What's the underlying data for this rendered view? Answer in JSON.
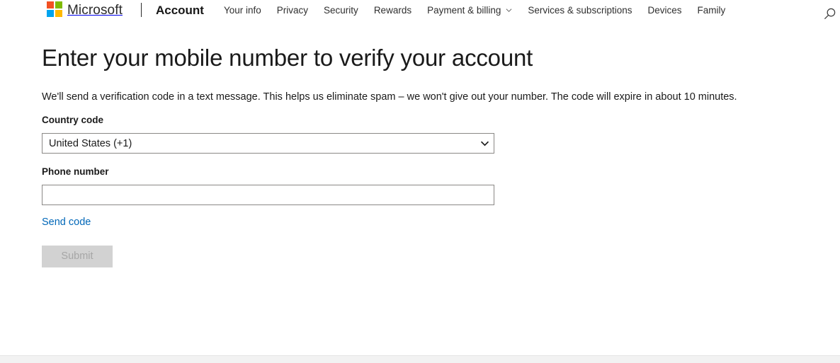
{
  "header": {
    "brand_name": "Microsoft",
    "logo_colors": {
      "top_left": "#f25022",
      "top_right": "#7fba00",
      "bottom_left": "#00a4ef",
      "bottom_right": "#ffb900"
    },
    "section_title": "Account",
    "nav_items": [
      {
        "label": "Your info",
        "has_caret": false
      },
      {
        "label": "Privacy",
        "has_caret": false
      },
      {
        "label": "Security",
        "has_caret": false
      },
      {
        "label": "Rewards",
        "has_caret": false
      },
      {
        "label": "Payment & billing",
        "has_caret": true
      },
      {
        "label": "Services & subscriptions",
        "has_caret": false
      },
      {
        "label": "Devices",
        "has_caret": false
      },
      {
        "label": "Family",
        "has_caret": false
      }
    ],
    "search_icon": "search-icon"
  },
  "main": {
    "title": "Enter your mobile number to verify your account",
    "intro": "We'll send a verification code in a text message. This helps us eliminate spam – we won't give out your number. The code will expire in about 10 minutes.",
    "country_field": {
      "label": "Country code",
      "selected_value": "United States (+1)",
      "caret_icon": "chevron-down-icon"
    },
    "phone_field": {
      "label": "Phone number",
      "value": "",
      "placeholder": ""
    },
    "send_code_link": "Send code",
    "submit_button": {
      "label": "Submit",
      "disabled": true
    }
  },
  "colors": {
    "link": "#0067b8",
    "text": "#1a1a1a",
    "border": "#8a8886",
    "disabled_bg": "#d2d2d2",
    "disabled_text": "#a6a6a6",
    "footer_band": "#f2f2f2"
  }
}
